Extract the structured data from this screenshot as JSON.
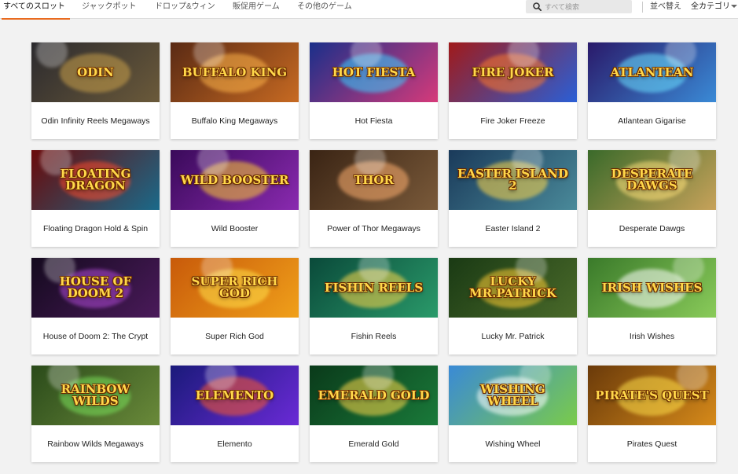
{
  "tabs": [
    {
      "label": "すべてのスロット",
      "active": true
    },
    {
      "label": "ジャックポット",
      "active": false
    },
    {
      "label": "ドロップ&ウィン",
      "active": false
    },
    {
      "label": "販促用ゲーム",
      "active": false
    },
    {
      "label": "その他のゲーム",
      "active": false
    }
  ],
  "search": {
    "placeholder": "すべて検索",
    "icon": "search-icon"
  },
  "sort": {
    "label": "並べ替え"
  },
  "category": {
    "label": "全カテゴリ",
    "icon": "caret-down-icon"
  },
  "games": [
    {
      "name": "Odin Infinity Reels Megaways",
      "logo": "ODIN",
      "bg": [
        "#2b2a2e",
        "#6b5a3a"
      ],
      "glow": "#c9a04a"
    },
    {
      "name": "Buffalo King Megaways",
      "logo": "BUFFALO KING",
      "bg": [
        "#5a2a14",
        "#c76a22"
      ],
      "glow": "#ffb54a"
    },
    {
      "name": "Hot Fiesta",
      "logo": "HOT FIESTA",
      "bg": [
        "#1a2f8a",
        "#d63a7a"
      ],
      "glow": "#3ad0ff"
    },
    {
      "name": "Fire Joker Freeze",
      "logo": "FIRE JOKER",
      "bg": [
        "#a01a1a",
        "#2a5fd6"
      ],
      "glow": "#ff7a2a"
    },
    {
      "name": "Atlantean Gigarise",
      "logo": "ATLANTEAN",
      "bg": [
        "#2a1a6a",
        "#3a8ad6"
      ],
      "glow": "#6ae0ff"
    },
    {
      "name": "Floating Dragon Hold & Spin",
      "logo": "FLOATING DRAGON",
      "bg": [
        "#6a0a0a",
        "#1a6a8a"
      ],
      "glow": "#ff4a2a"
    },
    {
      "name": "Wild Booster",
      "logo": "WILD BOOSTER",
      "bg": [
        "#3a0a5a",
        "#8a2ab0"
      ],
      "glow": "#ffcc33"
    },
    {
      "name": "Power of Thor Megaways",
      "logo": "THOR",
      "bg": [
        "#3a2414",
        "#7a5a3a"
      ],
      "glow": "#ffb070"
    },
    {
      "name": "Easter Island 2",
      "logo": "EASTER ISLAND 2",
      "bg": [
        "#1a3a5a",
        "#4a8a9a"
      ],
      "glow": "#ffd84a"
    },
    {
      "name": "Desperate Dawgs",
      "logo": "DESPERATE DAWGS",
      "bg": [
        "#3a6a2a",
        "#c7a25a"
      ],
      "glow": "#ffe07a"
    },
    {
      "name": "House of Doom 2: The Crypt",
      "logo": "HOUSE OF DOOM 2",
      "bg": [
        "#140a1e",
        "#4a1a5a"
      ],
      "glow": "#b04ad6"
    },
    {
      "name": "Super Rich God",
      "logo": "SUPER RICH GOD",
      "bg": [
        "#c85a0a",
        "#f0a01a"
      ],
      "glow": "#ffe04a"
    },
    {
      "name": "Fishin Reels",
      "logo": "FISHIN REELS",
      "bg": [
        "#0a4a3a",
        "#2a9a6a"
      ],
      "glow": "#ffd84a"
    },
    {
      "name": "Lucky Mr. Patrick",
      "logo": "LUCKY MR.PATRICK",
      "bg": [
        "#1a3a14",
        "#4a6a2a"
      ],
      "glow": "#ffcc33"
    },
    {
      "name": "Irish Wishes",
      "logo": "IRISH WISHES",
      "bg": [
        "#3a7a2a",
        "#8acb5a"
      ],
      "glow": "#ffffff"
    },
    {
      "name": "Rainbow Wilds Megaways",
      "logo": "RAINBOW WILDS",
      "bg": [
        "#2a4a1a",
        "#6a8a3a"
      ],
      "glow": "#7ae05a"
    },
    {
      "name": "Elemento",
      "logo": "ELEMENTO",
      "bg": [
        "#1a1a7a",
        "#6a2ad6"
      ],
      "glow": "#ff5a2a"
    },
    {
      "name": "Emerald Gold",
      "logo": "EMERALD GOLD",
      "bg": [
        "#0a3a1a",
        "#1a7a3a"
      ],
      "glow": "#ffd84a"
    },
    {
      "name": "Wishing Wheel",
      "logo": "WISHING WHEEL",
      "bg": [
        "#3a8ad6",
        "#7acb4a"
      ],
      "glow": "#ffffff"
    },
    {
      "name": "Pirates Quest",
      "logo": "PIRATE'S QUEST",
      "bg": [
        "#6a3a0a",
        "#d68a1a"
      ],
      "glow": "#ffe04a"
    }
  ]
}
